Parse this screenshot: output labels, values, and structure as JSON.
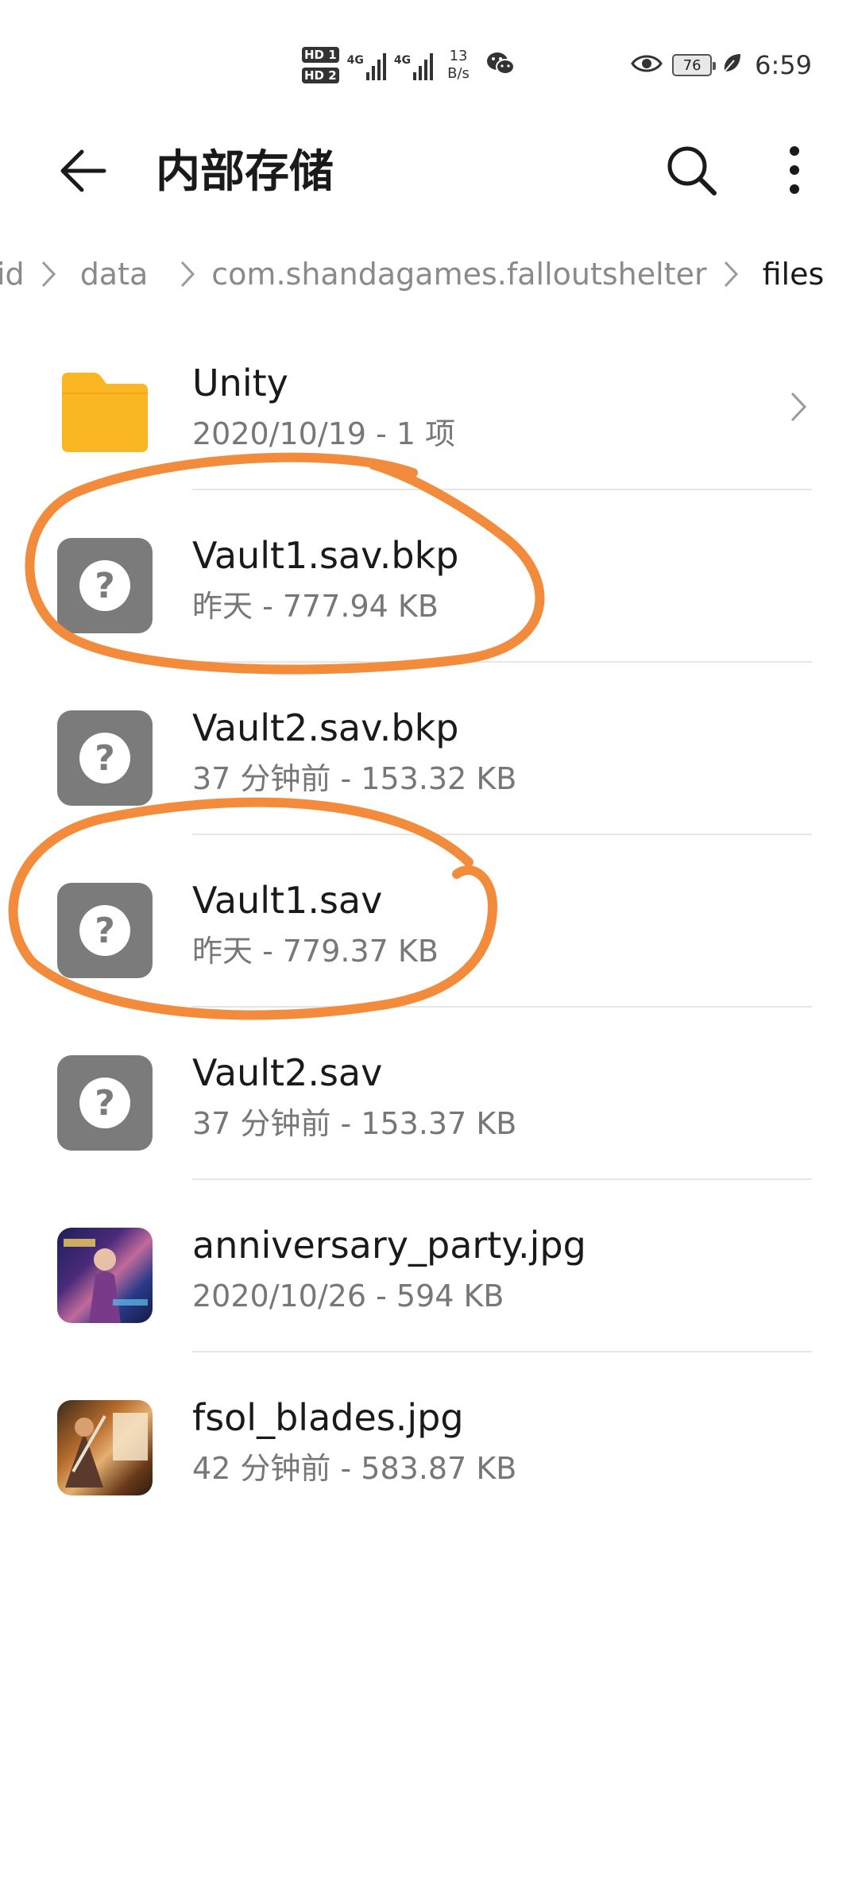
{
  "status_bar": {
    "hd1": "HD 1",
    "hd2": "HD 2",
    "net1": "4G",
    "net2": "4G",
    "speed_value": "13",
    "speed_unit": "B/s",
    "battery": "76",
    "time": "6:59",
    "icons": [
      "wechat-icon",
      "eye-icon",
      "leaf-icon"
    ]
  },
  "header": {
    "title": "内部存储",
    "icons": [
      "back-arrow-icon",
      "search-icon",
      "more-vert-icon"
    ]
  },
  "breadcrumb": {
    "items": [
      "id",
      "data",
      "com.shandagames.falloutshelter",
      "files"
    ]
  },
  "files": [
    {
      "name": "Unity",
      "meta": "2020/10/19 - 1 项",
      "type": "folder"
    },
    {
      "name": "Vault1.sav.bkp",
      "meta": "昨天 - 777.94 KB",
      "type": "unknown"
    },
    {
      "name": "Vault2.sav.bkp",
      "meta": "37 分钟前 - 153.32 KB",
      "type": "unknown"
    },
    {
      "name": "Vault1.sav",
      "meta": "昨天 - 779.37 KB",
      "type": "unknown"
    },
    {
      "name": "Vault2.sav",
      "meta": "37 分钟前 - 153.37 KB",
      "type": "unknown"
    },
    {
      "name": "anniversary_party.jpg",
      "meta": "2020/10/26 - 594 KB",
      "type": "image"
    },
    {
      "name": "fsol_blades.jpg",
      "meta": "42 分钟前 - 583.87 KB",
      "type": "image"
    }
  ],
  "colors": {
    "folder": "#FBB624",
    "unknown_icon_bg": "#7B7B7B",
    "annotation": "#F28C3C"
  }
}
